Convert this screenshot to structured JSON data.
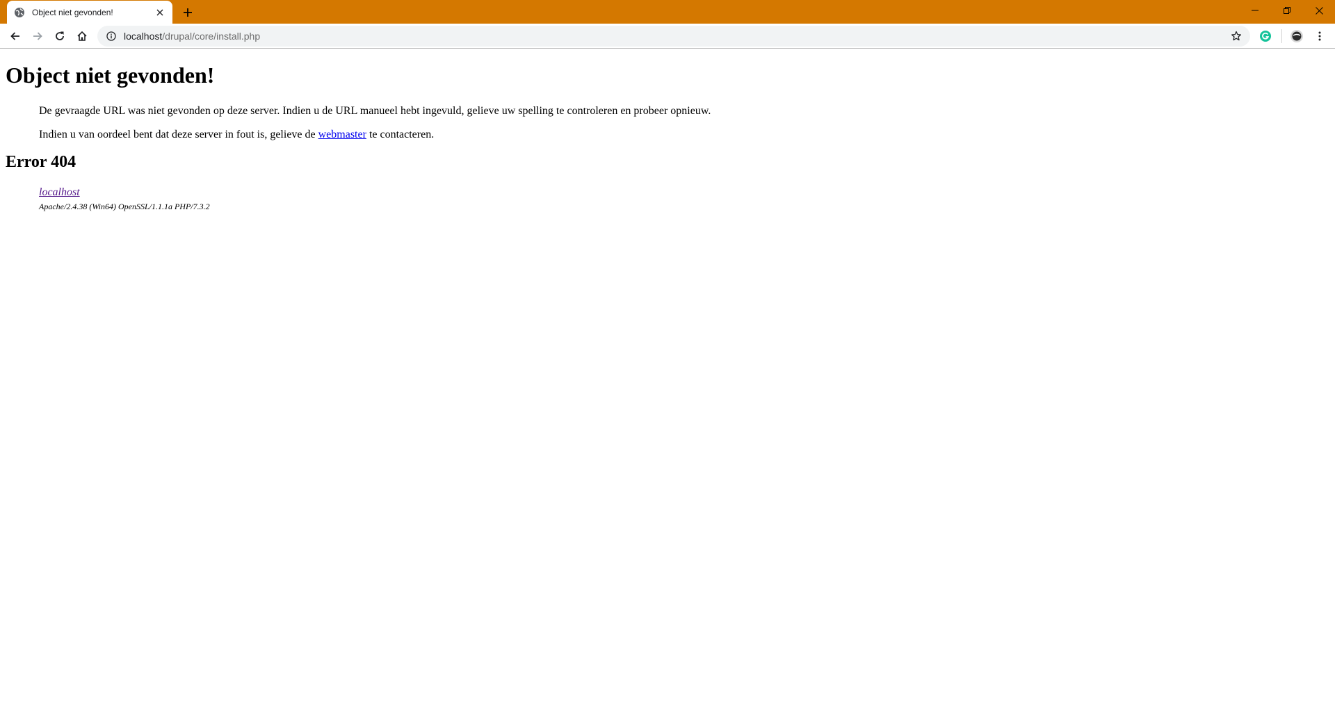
{
  "browser": {
    "accent_color": "#d47800",
    "tab": {
      "title": "Object niet gevonden!",
      "favicon": "globe-icon",
      "close_glyph": "✕"
    },
    "new_tab_icon": "plus-icon",
    "window_controls": [
      "minimize-icon",
      "restore-icon",
      "close-icon"
    ],
    "toolbar": {
      "back_icon": "arrow-left-icon",
      "forward_icon": "arrow-right-icon",
      "reload_icon": "reload-icon",
      "home_icon": "home-icon"
    },
    "omnibox": {
      "info_icon": "info-icon",
      "url_host": "localhost",
      "url_path": "/drupal/core/install.php",
      "bookmark_icon": "star-icon"
    },
    "extensions": [
      "grammarly-icon",
      "profile-avatar-icon",
      "kebab-menu-icon"
    ]
  },
  "page": {
    "title": "Object niet gevonden!",
    "paragraph1": "De gevraagde URL was niet gevonden op deze server. Indien u de URL manueel hebt ingevuld, gelieve uw spelling te controleren en probeer opnieuw.",
    "paragraph2_before": "Indien u van oordeel bent dat deze server in fout is, gelieve de ",
    "paragraph2_link": "webmaster",
    "paragraph2_after": " te contacteren.",
    "error_heading": "Error 404",
    "address_link": "localhost",
    "server_signature": "Apache/2.4.38 (Win64) OpenSSL/1.1.1a PHP/7.3.2"
  }
}
